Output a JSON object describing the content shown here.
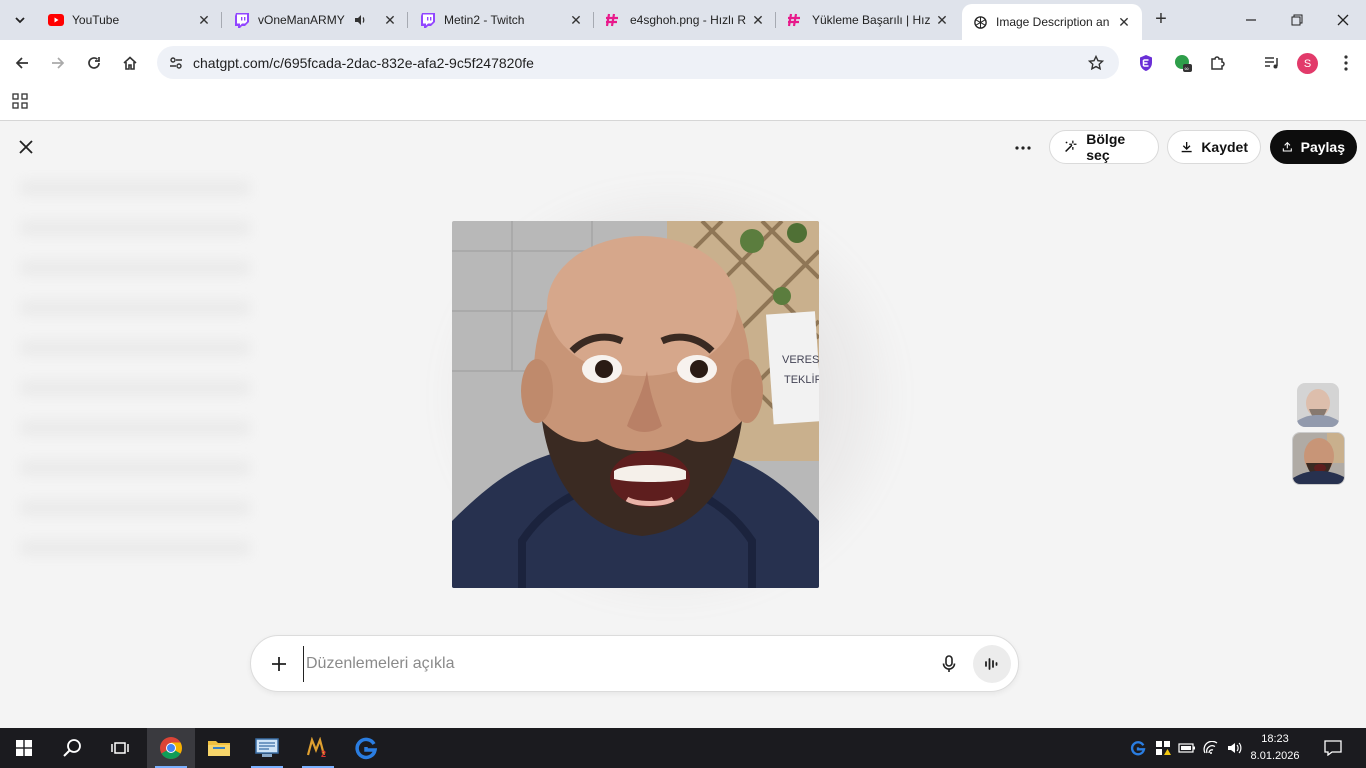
{
  "tabs": [
    {
      "title": "YouTube",
      "icon": "youtube-icon"
    },
    {
      "title": "vOneManARMY -",
      "icon": "twitch-icon",
      "audio": true
    },
    {
      "title": "Metin2 - Twitch",
      "icon": "twitch-icon"
    },
    {
      "title": "e4sghoh.png - Hızlı R",
      "icon": "hizli-resim-icon"
    },
    {
      "title": "Yükleme Başarılı | Hız",
      "icon": "hizli-resim-icon"
    },
    {
      "title": "Image Description an",
      "icon": "openai-icon",
      "active": true
    }
  ],
  "address_bar": {
    "url": "chatgpt.com/c/695fcada-2dac-832e-afa2-9c5f247820fe"
  },
  "profile": {
    "initial": "S",
    "color": "#e23a6a"
  },
  "editor": {
    "select_area_label": "Bölge seç",
    "save_label": "Kaydet",
    "share_label": "Paylaş"
  },
  "composer": {
    "placeholder": "Düzenlemeleri açıkla",
    "value": ""
  },
  "taskbar": {
    "time": "18:23",
    "date": "8.01.2026"
  },
  "colors": {
    "accent_dark": "#0d0d0d",
    "youtube_red": "#ff0000",
    "twitch_purple": "#9146ff",
    "hizli_pink": "#e8198b"
  }
}
